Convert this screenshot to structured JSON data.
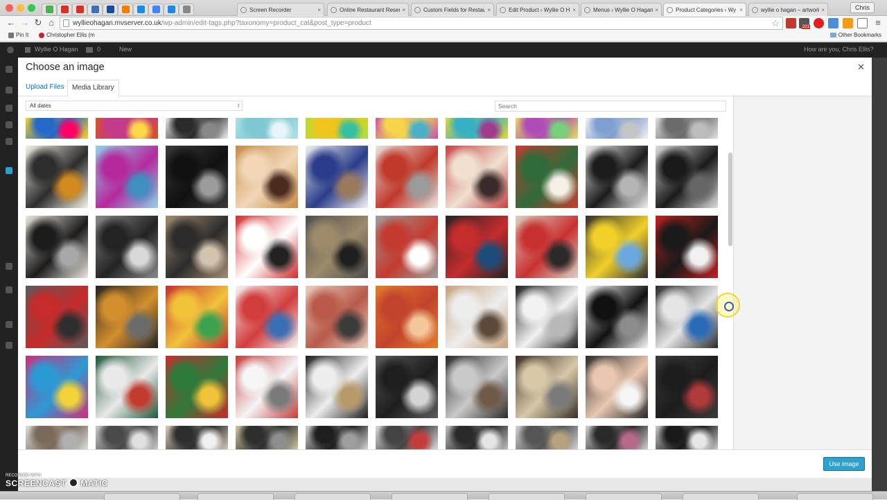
{
  "browser": {
    "tabs": [
      {
        "label": "Screen Recorder"
      },
      {
        "label": "Online Restaurant Reser"
      },
      {
        "label": "Custom Fields for Restau"
      },
      {
        "label": "Edit Product ‹ Wyllie O H"
      },
      {
        "label": "Menus ‹ Wyllie O Hagan"
      },
      {
        "label": "Product Categories ‹ Wy"
      },
      {
        "label": "wyllie o hagan – artwork"
      }
    ],
    "active_tab": 5,
    "profile_name": "Chris",
    "url_host": "wyllieohagan.mvserver.co.uk",
    "url_path": "/wp-admin/edit-tags.php?taxonomy=product_cat&post_type=product",
    "bookmarks": {
      "pin_label": "Pin It",
      "person_label": "Christopher Ellis (m",
      "other_label": "Other Bookmarks"
    },
    "extension_badge": "221"
  },
  "admin_bar": {
    "site_name": "Wyllie O Hagan",
    "comments_count": "0",
    "new_label": "New",
    "greeting": "How are you, Chris Ellis?"
  },
  "modal": {
    "title": "Choose an image",
    "tabs": [
      {
        "label": "Upload Files"
      },
      {
        "label": "Media Library"
      }
    ],
    "filter_selected": "All dates",
    "search_placeholder": "Search",
    "primary_button": "Use image",
    "close_icon": "close-icon"
  },
  "media_grid": {
    "columns": 10,
    "rows": [
      {
        "partial": true,
        "items": [
          {
            "colors": [
              "#ffd21e",
              "#2468c8",
              "#f06"
            ]
          },
          {
            "colors": [
              "#d8551a",
              "#c43a8c",
              "#ffd74a"
            ]
          },
          {
            "colors": [
              "#eeeeee",
              "#2b2b2b",
              "#888888"
            ]
          },
          {
            "colors": [
              "#aee3ea",
              "#7fc7d3",
              "#e7f6f8"
            ]
          },
          {
            "colors": [
              "#a6e33a",
              "#f0c41c",
              "#37c0a0"
            ]
          },
          {
            "colors": [
              "#c94fb0",
              "#f5d64a",
              "#4ab0c9"
            ]
          },
          {
            "colors": [
              "#e6d730",
              "#36b0c4",
              "#a03c8c"
            ]
          },
          {
            "colors": [
              "#e6df5a",
              "#b04cb7",
              "#78d07c"
            ]
          },
          {
            "colors": [
              "#f2f2f2",
              "#7f9fd3",
              "#c5c5c5"
            ]
          },
          {
            "colors": [
              "#e2e2e2",
              "#6b6b6b",
              "#bdbdbd"
            ]
          }
        ]
      },
      {
        "partial": false,
        "items": [
          {
            "colors": [
              "#f4f1e4",
              "#2d2d2d",
              "#d48a1d"
            ]
          },
          {
            "colors": [
              "#8fd3e8",
              "#b42a9e",
              "#3f8fc0"
            ]
          },
          {
            "colors": [
              "#3a3a3a",
              "#111111",
              "#9b9b9b"
            ]
          },
          {
            "colors": [
              "#c78a45",
              "#f1d7b6",
              "#4b2b1e"
            ]
          },
          {
            "colors": [
              "#f2f2f2",
              "#2b3d8a",
              "#9a7a5e"
            ]
          },
          {
            "colors": [
              "#e9e6e0",
              "#c0392b",
              "#9b9b9b"
            ]
          },
          {
            "colors": [
              "#c64343",
              "#f0e0d0",
              "#3b2a2a"
            ]
          },
          {
            "colors": [
              "#c63c2e",
              "#2f6b3b",
              "#f5f0e5"
            ]
          },
          {
            "colors": [
              "#f0f0f0",
              "#1c1c1c",
              "#b5b5b5"
            ]
          },
          {
            "colors": [
              "#dcdcdc",
              "#1a1a1a",
              "#666666"
            ]
          }
        ]
      },
      {
        "partial": false,
        "items": [
          {
            "colors": [
              "#efe7de",
              "#1c1c1c",
              "#a8a8a8"
            ]
          },
          {
            "colors": [
              "#8a8a8a",
              "#232323",
              "#d9d9d9"
            ]
          },
          {
            "colors": [
              "#a48b70",
              "#2c2c2c",
              "#d3c4b0"
            ]
          },
          {
            "colors": [
              "#d32b2b",
              "#ffffff",
              "#222222"
            ]
          },
          {
            "colors": [
              "#4f4f4f",
              "#9c8a6a",
              "#1f1f1f"
            ]
          },
          {
            "colors": [
              "#9d9d9d",
              "#c33b2f",
              "#ffffff"
            ]
          },
          {
            "colors": [
              "#252525",
              "#c52c2c",
              "#1a4d7a"
            ]
          },
          {
            "colors": [
              "#d9d2c3",
              "#c93131",
              "#2a2a2a"
            ]
          },
          {
            "colors": [
              "#2f2f2f",
              "#f2d02a",
              "#6aa9e0"
            ]
          },
          {
            "colors": [
              "#c52020",
              "#1a1a1a",
              "#f0f0f0"
            ]
          }
        ]
      },
      {
        "partial": false,
        "items": [
          {
            "colors": [
              "#5a5a5a",
              "#c72b2b",
              "#2e2e2e"
            ]
          },
          {
            "colors": [
              "#222222",
              "#d48f2d",
              "#6b6b6b"
            ]
          },
          {
            "colors": [
              "#c62f2f",
              "#f1c23a",
              "#3ca24d"
            ]
          },
          {
            "colors": [
              "#f5f5f5",
              "#d23c3c",
              "#3b6fb3"
            ]
          },
          {
            "colors": [
              "#e8cfc2",
              "#b95a4a",
              "#3b3b3b"
            ]
          },
          {
            "colors": [
              "#e37b2c",
              "#c2442c",
              "#f4c79a"
            ]
          },
          {
            "colors": [
              "#c9a17b",
              "#ededed",
              "#5b4a3a"
            ]
          },
          {
            "colors": [
              "#1f1f1f",
              "#f2f2f2",
              "#b8b8b8"
            ]
          },
          {
            "colors": [
              "#f7f7f7",
              "#111111",
              "#8c8c8c"
            ]
          },
          {
            "colors": [
              "#2b2b2b",
              "#e5e5e5",
              "#2a6bb6"
            ]
          }
        ]
      },
      {
        "partial": false,
        "items": [
          {
            "colors": [
              "#d42c7a",
              "#2b9ad4",
              "#f3d23a"
            ]
          },
          {
            "colors": [
              "#1f5a3a",
              "#e9e9e9",
              "#c33b2f"
            ]
          },
          {
            "colors": [
              "#c92c2c",
              "#2d7a3b",
              "#f0c33a"
            ]
          },
          {
            "colors": [
              "#c63c3c",
              "#f5f5f5",
              "#7a7a7a"
            ]
          },
          {
            "colors": [
              "#1e1e1e",
              "#ededed",
              "#b89a6a"
            ]
          },
          {
            "colors": [
              "#5b5b5b",
              "#1e1e1e",
              "#d4d4d4"
            ]
          },
          {
            "colors": [
              "#2b2b2b",
              "#c9c9c9",
              "#6e5a46"
            ]
          },
          {
            "colors": [
              "#3a2f26",
              "#d8c8a8",
              "#7a7a7a"
            ]
          },
          {
            "colors": [
              "#2a2a2a",
              "#e9c7b0",
              "#f5f5f5"
            ]
          },
          {
            "colors": [
              "#3c3c3c",
              "#1d1d1d",
              "#b13a3a"
            ]
          }
        ]
      },
      {
        "partial": true,
        "items": [
          {
            "colors": [
              "#dcdcdc",
              "#7a6a5a",
              "#b0b0b0"
            ]
          },
          {
            "colors": [
              "#c9c9c9",
              "#4a4a4a",
              "#e0e0e0"
            ]
          },
          {
            "colors": [
              "#d7c9b5",
              "#2e2e2e",
              "#f0f0f0"
            ]
          },
          {
            "colors": [
              "#cfc6a0",
              "#2e2e2e",
              "#8e8e8e"
            ]
          },
          {
            "colors": [
              "#d5d5d5",
              "#1e1e1e",
              "#9e9e9e"
            ]
          },
          {
            "colors": [
              "#d9d9d9",
              "#444444",
              "#c63c3c"
            ]
          },
          {
            "colors": [
              "#bdbdbd",
              "#2a2a2a",
              "#e5e5e5"
            ]
          },
          {
            "colors": [
              "#d2d2d2",
              "#555555",
              "#b6a27e"
            ]
          },
          {
            "colors": [
              "#cfcfcf",
              "#2a2a2a",
              "#b56a8a"
            ]
          },
          {
            "colors": [
              "#c8c8c8",
              "#1a1a1a",
              "#e6e6e6"
            ]
          }
        ]
      }
    ]
  },
  "overlay": {
    "watermark_small": "RECORDED WITH",
    "watermark_brand_left": "SCREENCAST",
    "watermark_brand_right": "MATIC"
  },
  "colors": {
    "link": "#0073aa",
    "button": "#2ea2cc",
    "adminbar": "#222222"
  }
}
